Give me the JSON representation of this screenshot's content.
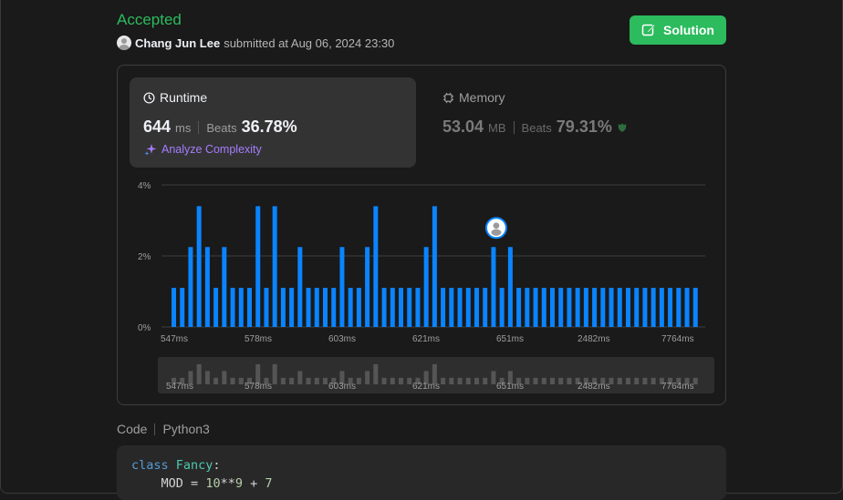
{
  "submission": {
    "status": "Accepted",
    "user": "Chang Jun Lee",
    "submitted_text": "submitted at Aug 06, 2024 23:30",
    "solution_label": "Solution"
  },
  "runtime": {
    "label": "Runtime",
    "value": "644",
    "unit": "ms",
    "beats_label": "Beats",
    "beats_value": "36.78%",
    "analyze_label": "Analyze Complexity"
  },
  "memory": {
    "label": "Memory",
    "value": "53.04",
    "unit": "MB",
    "beats_label": "Beats",
    "beats_value": "79.31%"
  },
  "chart_data": {
    "type": "bar",
    "y_ticks": [
      "4%",
      "2%",
      "0%"
    ],
    "ylim": [
      0,
      4
    ],
    "x_tick_labels": [
      "547ms",
      "578ms",
      "603ms",
      "621ms",
      "651ms",
      "2482ms",
      "7764ms"
    ],
    "values": [
      1.1,
      1.1,
      2.25,
      3.4,
      2.25,
      1.1,
      2.25,
      1.1,
      1.1,
      1.1,
      3.4,
      1.1,
      3.4,
      1.1,
      1.1,
      2.25,
      1.1,
      1.1,
      1.1,
      1.1,
      2.25,
      1.1,
      1.1,
      2.25,
      3.4,
      1.1,
      1.1,
      1.1,
      1.1,
      1.1,
      2.25,
      3.4,
      1.1,
      1.1,
      1.1,
      1.1,
      1.1,
      1.1,
      2.25,
      1.1,
      2.25,
      1.1,
      1.1,
      1.1,
      1.1,
      1.1,
      1.1,
      1.1,
      1.1,
      1.1,
      1.1,
      1.1,
      1.1,
      1.1,
      1.1,
      1.1,
      1.1,
      1.1,
      1.1,
      1.1,
      1.1,
      1.1,
      1.1
    ],
    "user_bar_index": 38,
    "bar_color": "#0a84ff",
    "navigator_bar_color": "#555555"
  },
  "code": {
    "label": "Code",
    "language": "Python3",
    "line1_kw": "class",
    "line1_name": "Fancy",
    "line1_colon": ":",
    "line2_ident": "MOD",
    "line2_eq": "=",
    "line2_base": "10",
    "line2_pow": "**",
    "line2_exp": "9",
    "line2_plus": "+",
    "line2_add": "7"
  },
  "colors": {
    "accent_green": "#2cbb5d",
    "accent_blue": "#0a84ff",
    "accent_purple": "#a57dff"
  }
}
